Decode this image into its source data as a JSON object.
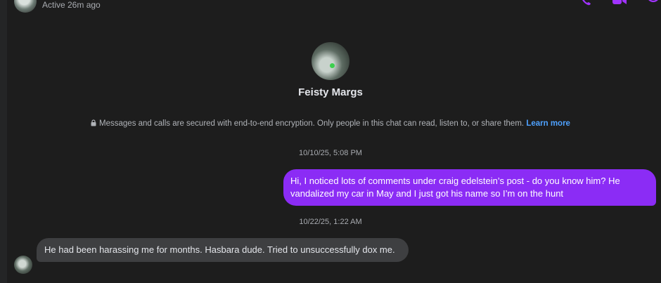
{
  "header": {
    "active_status": "Active 26m ago"
  },
  "icons": {
    "phone": "phone-icon",
    "video": "video-icon",
    "info": "info-icon"
  },
  "colors": {
    "accent": "#a033ff",
    "outgoing_bubble": "#8b2cf5",
    "incoming_bubble": "#3e3f41",
    "link": "#4ea1ff"
  },
  "profile": {
    "name": "Feisty Margs"
  },
  "encryption": {
    "text": "Messages and calls are secured with end-to-end encryption. Only people in this chat can read, listen to, or share them.",
    "link_label": "Learn more"
  },
  "messages": [
    {
      "timestamp": "10/10/25, 5:08 PM",
      "direction": "outgoing",
      "text": "Hi, I noticed lots of comments under craig edelstein’s post - do you know him? He vandalized my car in May and I just got his name so I’m on the hunt"
    },
    {
      "timestamp": "10/22/25, 1:22 AM",
      "direction": "incoming",
      "text": "He had been harassing me for months. Hasbara dude. Tried to unsuccessfully dox me."
    }
  ]
}
